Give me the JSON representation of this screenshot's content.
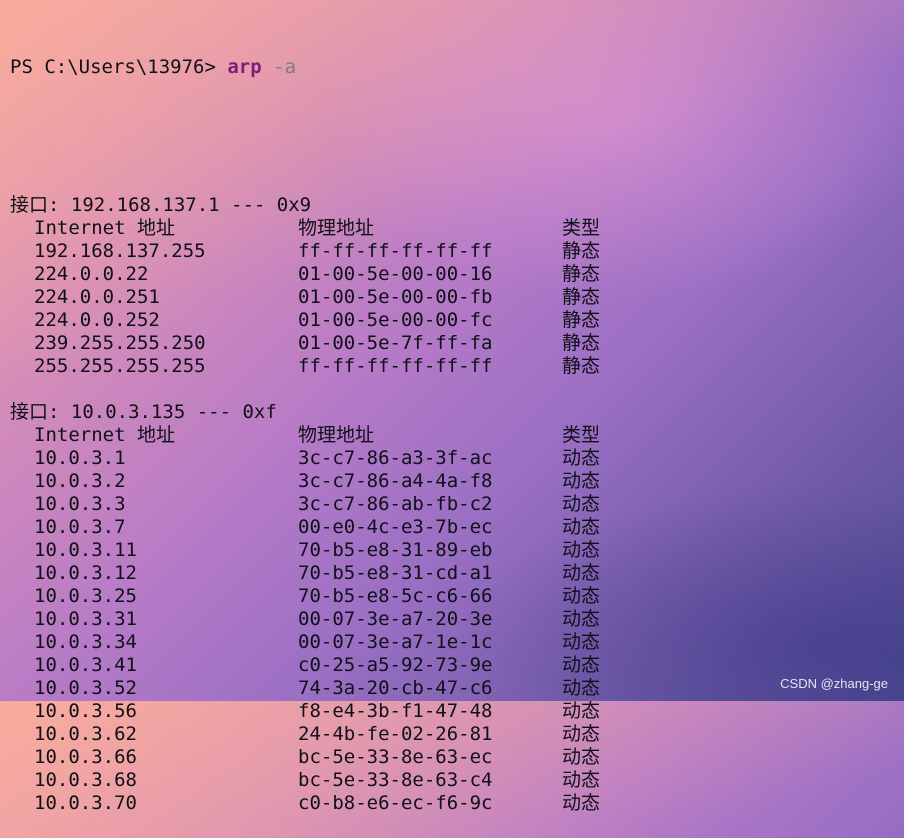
{
  "prompt": {
    "prefix": "PS C:\\Users\\13976> ",
    "command": "arp",
    "flag": "-a"
  },
  "interfaces": [
    {
      "header": "接口: 192.168.137.1 --- 0x9",
      "col_headers": [
        "Internet 地址",
        "物理地址",
        "类型"
      ],
      "rows": [
        [
          "192.168.137.255",
          "ff-ff-ff-ff-ff-ff",
          "静态"
        ],
        [
          "224.0.0.22",
          "01-00-5e-00-00-16",
          "静态"
        ],
        [
          "224.0.0.251",
          "01-00-5e-00-00-fb",
          "静态"
        ],
        [
          "224.0.0.252",
          "01-00-5e-00-00-fc",
          "静态"
        ],
        [
          "239.255.255.250",
          "01-00-5e-7f-ff-fa",
          "静态"
        ],
        [
          "255.255.255.255",
          "ff-ff-ff-ff-ff-ff",
          "静态"
        ]
      ]
    },
    {
      "header": "接口: 10.0.3.135 --- 0xf",
      "col_headers": [
        "Internet 地址",
        "物理地址",
        "类型"
      ],
      "rows": [
        [
          "10.0.3.1",
          "3c-c7-86-a3-3f-ac",
          "动态"
        ],
        [
          "10.0.3.2",
          "3c-c7-86-a4-4a-f8",
          "动态"
        ],
        [
          "10.0.3.3",
          "3c-c7-86-ab-fb-c2",
          "动态"
        ],
        [
          "10.0.3.7",
          "00-e0-4c-e3-7b-ec",
          "动态"
        ],
        [
          "10.0.3.11",
          "70-b5-e8-31-89-eb",
          "动态"
        ],
        [
          "10.0.3.12",
          "70-b5-e8-31-cd-a1",
          "动态"
        ],
        [
          "10.0.3.25",
          "70-b5-e8-5c-c6-66",
          "动态"
        ],
        [
          "10.0.3.31",
          "00-07-3e-a7-20-3e",
          "动态"
        ],
        [
          "10.0.3.34",
          "00-07-3e-a7-1e-1c",
          "动态"
        ],
        [
          "10.0.3.41",
          "c0-25-a5-92-73-9e",
          "动态"
        ],
        [
          "10.0.3.52",
          "74-3a-20-cb-47-c6",
          "动态"
        ],
        [
          "10.0.3.56",
          "f8-e4-3b-f1-47-48",
          "动态"
        ],
        [
          "10.0.3.62",
          "24-4b-fe-02-26-81",
          "动态"
        ],
        [
          "10.0.3.66",
          "bc-5e-33-8e-63-ec",
          "动态"
        ],
        [
          "10.0.3.68",
          "bc-5e-33-8e-63-c4",
          "动态"
        ],
        [
          "10.0.3.70",
          "c0-b8-e6-ec-f6-9c",
          "动态"
        ]
      ]
    }
  ],
  "watermark": "CSDN @zhang-ge"
}
